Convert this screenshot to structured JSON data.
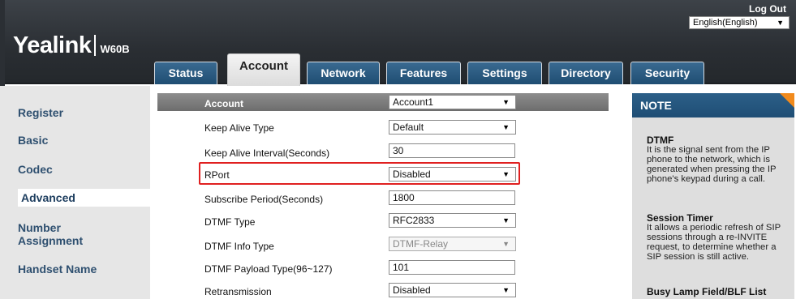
{
  "header": {
    "logo_brand": "Yealink",
    "logo_model": "W60B",
    "logout": "Log Out",
    "language": "English(English)"
  },
  "tabs": [
    {
      "label": "Status"
    },
    {
      "label": "Account",
      "active": true
    },
    {
      "label": "Network"
    },
    {
      "label": "Features"
    },
    {
      "label": "Settings"
    },
    {
      "label": "Directory"
    },
    {
      "label": "Security"
    }
  ],
  "sidebar": {
    "items": [
      {
        "label": "Register"
      },
      {
        "label": "Basic"
      },
      {
        "label": "Codec"
      },
      {
        "label": "Advanced",
        "active": true
      },
      {
        "label": "Number Assignment"
      },
      {
        "label": "Handset Name"
      }
    ]
  },
  "form": {
    "account_label": "Account",
    "account_value": "Account1",
    "rows": [
      {
        "label": "Keep Alive Type",
        "value": "Default",
        "type": "select"
      },
      {
        "label": "Keep Alive Interval(Seconds)",
        "value": "30",
        "type": "input"
      },
      {
        "label": "RPort",
        "value": "Disabled",
        "type": "select"
      },
      {
        "label": "Subscribe Period(Seconds)",
        "value": "1800",
        "type": "input"
      },
      {
        "label": "DTMF Type",
        "value": "RFC2833",
        "type": "select"
      },
      {
        "label": "DTMF Info Type",
        "value": "DTMF-Relay",
        "type": "select-disabled"
      },
      {
        "label": "DTMF Payload Type(96~127)",
        "value": "101",
        "type": "input"
      },
      {
        "label": "Retransmission",
        "value": "Disabled",
        "type": "select"
      }
    ]
  },
  "note": {
    "title": "NOTE",
    "sections": [
      {
        "title": "DTMF",
        "body": "It is the signal sent from the IP phone to the network, which is generated when pressing the IP phone's keypad during a call."
      },
      {
        "title": "Session Timer",
        "body": "It allows a periodic refresh of SIP sessions through a re-INVITE request, to determine whether a SIP session is still active."
      },
      {
        "title": "Busy Lamp Field/BLF List",
        "body": ""
      }
    ]
  },
  "colors": {
    "tab_blue": "#1f4d72",
    "highlight_red": "#e02020",
    "note_accent": "#f18a1c"
  }
}
